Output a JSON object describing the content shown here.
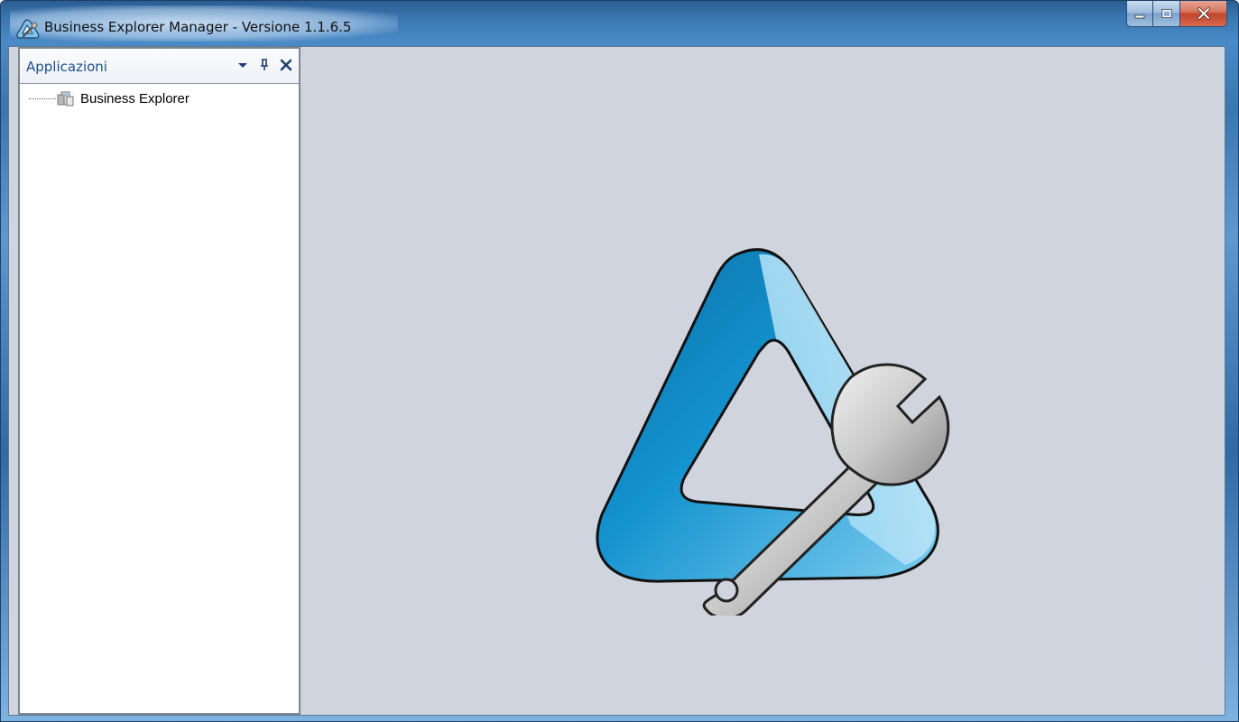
{
  "window": {
    "title": "Business Explorer Manager - Versione 1.1.6.5",
    "icons": {
      "app": "app-logo-icon",
      "minimize": "minimize-icon",
      "maximize": "maximize-icon",
      "close": "close-icon"
    },
    "colors": {
      "close_button": "#c2452a",
      "titlebar": "#3b78b3"
    }
  },
  "panel": {
    "title": "Applicazioni",
    "tools": [
      "dropdown-arrow-icon",
      "pin-icon",
      "close-panel-icon"
    ],
    "tree": [
      {
        "label": "Business Explorer",
        "icon": "application-node-icon"
      }
    ]
  },
  "main": {
    "background": "#cfd4de",
    "logo": "business-explorer-wrench-logo"
  }
}
